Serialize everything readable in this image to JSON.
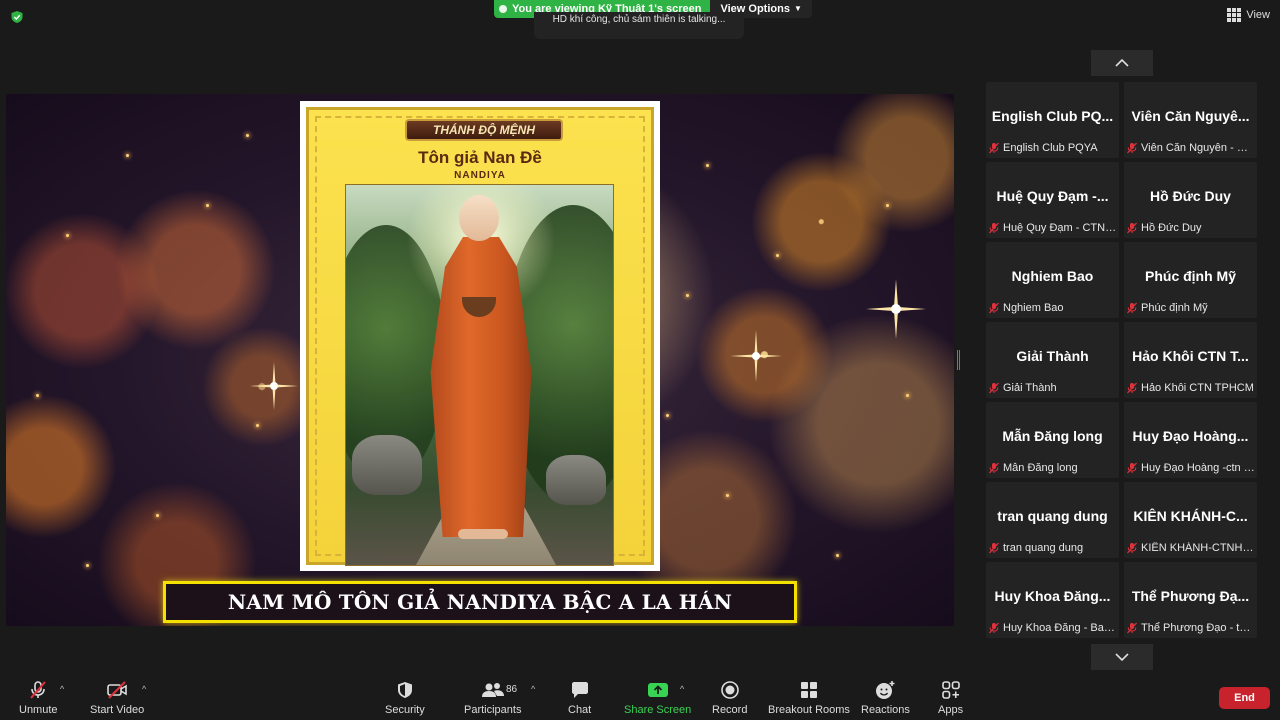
{
  "top": {
    "share_banner": "You are viewing Kỹ Thuật 1's screen",
    "view_options": "View Options",
    "talking": "HD khí công, chủ sám thiên is talking...",
    "view_label": "View"
  },
  "shared": {
    "poster_tag": "THÁNH ĐỘ MỆNH",
    "poster_title": "Tôn giả Nan Đề",
    "poster_subtitle": "NANDIYA",
    "caption": "NAM MÔ TÔN GIẢ NANDIYA BẬC A LA HÁN"
  },
  "gallery": {
    "tiles": [
      {
        "name": "English Club PQ...",
        "label": "English Club PQYA"
      },
      {
        "name": "Viên Căn Nguyê...",
        "label": "Viên Căn Nguyên - CT..."
      },
      {
        "name": "Huệ Quy Đạm -...",
        "label": "Huệ Quy Đạm - CTN H..."
      },
      {
        "name": "Hồ Đức Duy",
        "label": "Hồ Đức Duy"
      },
      {
        "name": "Nghiem Bao",
        "label": "Nghiem Bao"
      },
      {
        "name": "Phúc định Mỹ",
        "label": "Phúc định Mỹ"
      },
      {
        "name": "Giải Thành",
        "label": "Giải Thành"
      },
      {
        "name": "Hảo Khôi CTN T...",
        "label": "Hảo Khôi CTN TPHCM"
      },
      {
        "name": "Mẫn Đăng long",
        "label": "Mẫn Đăng long"
      },
      {
        "name": "Huy Đạo Hoàng...",
        "label": "Huy Đạo Hoàng -ctn Đ..."
      },
      {
        "name": "tran quang dung",
        "label": "tran quang dung"
      },
      {
        "name": "KIÊN KHÁNH-C...",
        "label": "KIÊN KHÁNH-CTNHCM"
      },
      {
        "name": "Huy Khoa Đăng...",
        "label": "Huy Khoa Đăng - Balan"
      },
      {
        "name": "Thể Phương Đạ...",
        "label": "Thể Phương Đạo - tổ ..."
      }
    ]
  },
  "toolbar": {
    "unmute": "Unmute",
    "start_video": "Start Video",
    "security": "Security",
    "participants": "Participants",
    "participants_count": "86",
    "chat": "Chat",
    "share_screen": "Share Screen",
    "record": "Record",
    "breakout_rooms": "Breakout Rooms",
    "reactions": "Reactions",
    "apps": "Apps",
    "end": "End"
  },
  "colors": {
    "share_green": "#2fb344",
    "end_red": "#c8232c",
    "caption_border": "#f5e100",
    "mic_muted": "#e0313c"
  }
}
